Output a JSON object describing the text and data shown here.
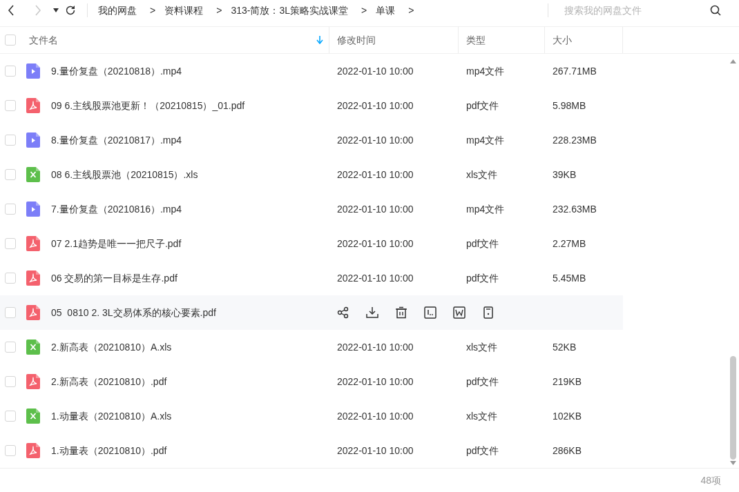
{
  "toolbar": {
    "back_enabled": true,
    "forward_enabled": false,
    "breadcrumbs": [
      "我的网盘",
      "资料课程",
      "313-简放：3L策略实战课堂",
      "单课"
    ],
    "separator": ">",
    "search": {
      "placeholder": "搜索我的网盘文件"
    }
  },
  "table": {
    "select_all_checked": false,
    "columns": [
      {
        "label": "文件名",
        "sorted": true
      },
      {
        "label": "修改时间",
        "sorted": false
      },
      {
        "label": "类型",
        "sorted": false
      },
      {
        "label": "大小",
        "sorted": false
      }
    ],
    "rows": [
      {
        "kind": "mp4",
        "name": "9.量价复盘（20210818）.mp4",
        "modified": "2022-01-10 10:00",
        "type": "mp4文件",
        "size": "267.71MB",
        "checked": false,
        "hovered": false
      },
      {
        "kind": "pdf",
        "name": "09 6.主线股票池更新！（20210815）_01.pdf",
        "modified": "2022-01-10 10:00",
        "type": "pdf文件",
        "size": "5.98MB",
        "checked": false,
        "hovered": false
      },
      {
        "kind": "mp4",
        "name": "8.量价复盘（20210817）.mp4",
        "modified": "2022-01-10 10:00",
        "type": "mp4文件",
        "size": "228.23MB",
        "checked": false,
        "hovered": false
      },
      {
        "kind": "xls",
        "name": "08 6.主线股票池（20210815）.xls",
        "modified": "2022-01-10 10:00",
        "type": "xls文件",
        "size": "39KB",
        "checked": false,
        "hovered": false
      },
      {
        "kind": "mp4",
        "name": "7.量价复盘（20210816）.mp4",
        "modified": "2022-01-10 10:00",
        "type": "mp4文件",
        "size": "232.63MB",
        "checked": false,
        "hovered": false
      },
      {
        "kind": "pdf",
        "name": "07 2.1趋势是唯一一把尺子.pdf",
        "modified": "2022-01-10 10:00",
        "type": "pdf文件",
        "size": "2.27MB",
        "checked": false,
        "hovered": false
      },
      {
        "kind": "pdf",
        "name": "06 交易的第一目标是生存.pdf",
        "modified": "2022-01-10 10:00",
        "type": "pdf文件",
        "size": "5.45MB",
        "checked": false,
        "hovered": false
      },
      {
        "kind": "pdf",
        "name": "05  0810 2. 3L交易体系的核心要素.pdf",
        "checked": false,
        "hovered": true
      },
      {
        "kind": "xls",
        "name": "2.新高表（20210810）A.xls",
        "modified": "2022-01-10 10:00",
        "type": "xls文件",
        "size": "52KB",
        "checked": false,
        "hovered": false
      },
      {
        "kind": "pdf",
        "name": "2.新高表（20210810）.pdf",
        "modified": "2022-01-10 10:00",
        "type": "pdf文件",
        "size": "219KB",
        "checked": false,
        "hovered": false
      },
      {
        "kind": "xls",
        "name": "1.动量表（20210810）A.xls",
        "modified": "2022-01-10 10:00",
        "type": "xls文件",
        "size": "102KB",
        "checked": false,
        "hovered": false
      },
      {
        "kind": "pdf",
        "name": "1.动量表（20210810）.pdf",
        "modified": "2022-01-10 10:00",
        "type": "pdf文件",
        "size": "286KB",
        "checked": false,
        "hovered": false
      }
    ]
  },
  "status_bar": {
    "count": "48项"
  }
}
